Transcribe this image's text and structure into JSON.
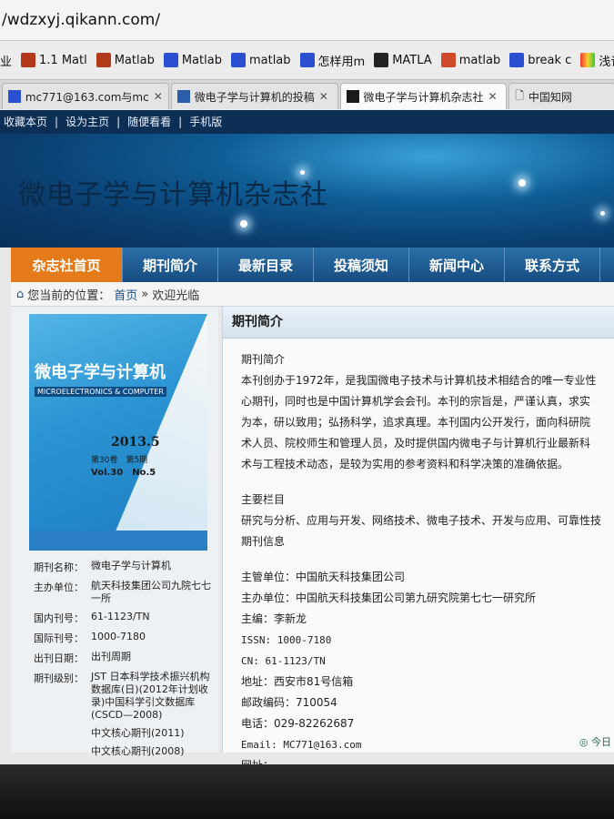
{
  "browser": {
    "url": "/wdzxyj.qikann.com/",
    "bookmarks": [
      "业",
      "1.1 Matl",
      "Matlab",
      "Matlab",
      "matlab",
      "怎样用m",
      "MATLA",
      "matlab",
      "break c",
      "浅谈图像"
    ],
    "tabs": [
      {
        "label": "mc771@163.com与mc",
        "active": false
      },
      {
        "label": "微电子学与计算机的投稿",
        "active": false
      },
      {
        "label": "微电子学与计算机杂志社",
        "active": true
      },
      {
        "label": "中国知网",
        "active": false
      }
    ]
  },
  "site": {
    "topbar": [
      "收藏本页",
      "|",
      "设为主页",
      "|",
      "随便看看",
      "|",
      "手机版"
    ],
    "title": "微电子学与计算机杂志社",
    "nav": [
      "杂志社首页",
      "期刊简介",
      "最新目录",
      "投稿须知",
      "新闻中心",
      "联系方式"
    ],
    "breadcrumb": {
      "prefix": "您当前的位置：",
      "home": "首页",
      "sep": "»",
      "current": "欢迎光临"
    }
  },
  "cover": {
    "title": "微电子学与计算机",
    "english": "MICROELECTRONICS & COMPUTER",
    "year": "2013.5",
    "vol": "第30卷　第5期",
    "vol_en": "Vol.30　No.5"
  },
  "journal_info": [
    {
      "k": "期刊名称：",
      "v": "微电子学与计算机"
    },
    {
      "k": "主办单位：",
      "v": "航天科技集团公司九院七七一所"
    },
    {
      "k": "国内刊号：",
      "v": "61-1123/TN"
    },
    {
      "k": "国际刊号：",
      "v": "1000-7180"
    },
    {
      "k": "出刊日期：",
      "v": "出刊周期"
    },
    {
      "k": "期刊级别：",
      "v": "JST 日本科学技术振兴机构数据库(日)(2012年计划收录)中国科学引文数据库(CSCD—2008)"
    },
    {
      "k": "",
      "v": "中文核心期刊(2011)"
    },
    {
      "k": "",
      "v": "中文核心期刊(2008)"
    }
  ],
  "panel": {
    "heading": "期刊简介",
    "lines": [
      "期刊简介",
      "本刊创办于1972年，是我国微电子技术与计算机技术相结合的唯一专业性",
      "心期刊，同时也是中国计算机学会会刊。本刊的宗旨是，严谨认真，求实",
      "为本，研以致用；弘扬科学，追求真理。本刊国内公开发行，面向科研院",
      "术人员、院校师生和管理人员，及时提供国内微电子与计算机行业最新科",
      "术与工程技术动态，是较为实用的参考资料和科学决策的准确依据。"
    ],
    "columns_title": "主要栏目",
    "columns": "研究与分析、应用与开发、网络技术、微电子技术、开发与应用、可靠性技",
    "info_title": "期刊信息",
    "details": [
      "主管单位：中国航天科技集团公司",
      "主办单位：中国航天科技集团公司第九研究院第七七一研究所",
      "主编：李新龙",
      "ISSN: 1000-7180",
      "CN: 61-1123/TN",
      "地址：西安市81号信箱",
      "邮政编码：710054",
      "电话：029-82262687",
      "Email: MC771@163.com",
      "网址："
    ],
    "today": "今日"
  }
}
